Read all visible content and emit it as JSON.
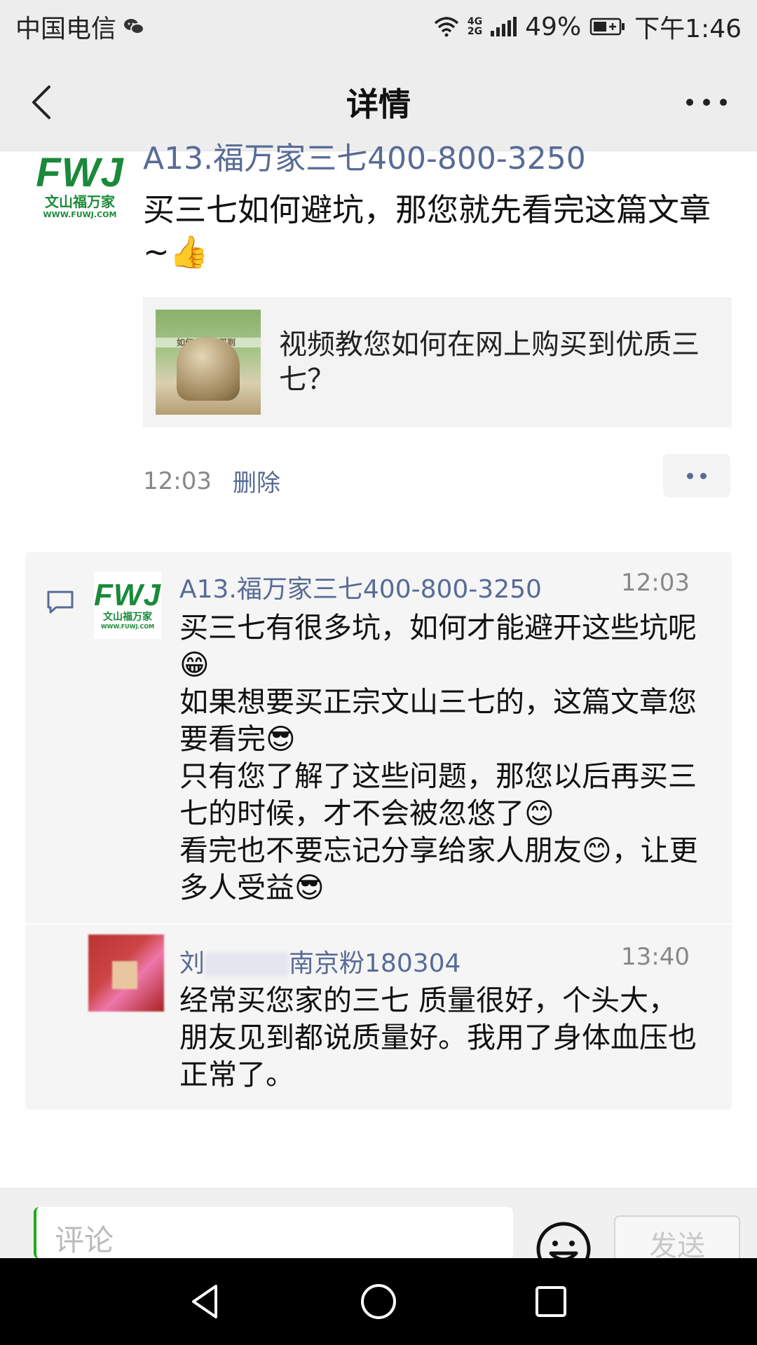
{
  "status_bar": {
    "carrier": "中国电信",
    "network_top": "4G",
    "network_bottom": "2G",
    "battery": "49%",
    "time": "下午1:46",
    "icons": [
      "wechat-icon",
      "wifi-icon",
      "signal-icon",
      "battery-charging-icon"
    ]
  },
  "header": {
    "title": "详情",
    "back_icon": "chevron-left-icon",
    "more_icon": "more-icon"
  },
  "post": {
    "author": "A13.福万家三七400-800-3250",
    "avatar": {
      "logo": "FWJ",
      "sub": "文山福万家",
      "url": "WWW.FUWJ.COM"
    },
    "text": "买三七如何避坑，那您就先看完这篇文章~👍",
    "link_card": {
      "title": "视频教您如何在网上购买到优质三七？",
      "thumb_caption": "如何在网上买到"
    },
    "time": "12:03",
    "delete_label": "删除"
  },
  "comments": [
    {
      "name": "A13.福万家三七400-800-3250",
      "time": "12:03",
      "text": "买三七有很多坑，如何才能避开这些坑呢😁\n如果想要买正宗文山三七的，这篇文章您要看完😎\n只有您了解了这些问题，那您以后再买三七的时候，才不会被忽悠了😊\n看完也不要忘记分享给家人朋友😊，让更多人受益😎"
    },
    {
      "name_prefix": "刘",
      "name_suffix": "南京粉180304",
      "time": "13:40",
      "text": "经常买您家的三七 质量很好，个头大，朋友见到都说质量好。我用了身体血压也正常了。"
    }
  ],
  "input_bar": {
    "placeholder": "评论",
    "send_label": "发送"
  },
  "colors": {
    "link_blue": "#576b95",
    "brand_green": "#1a8a3a",
    "header_bg": "#ededed"
  }
}
